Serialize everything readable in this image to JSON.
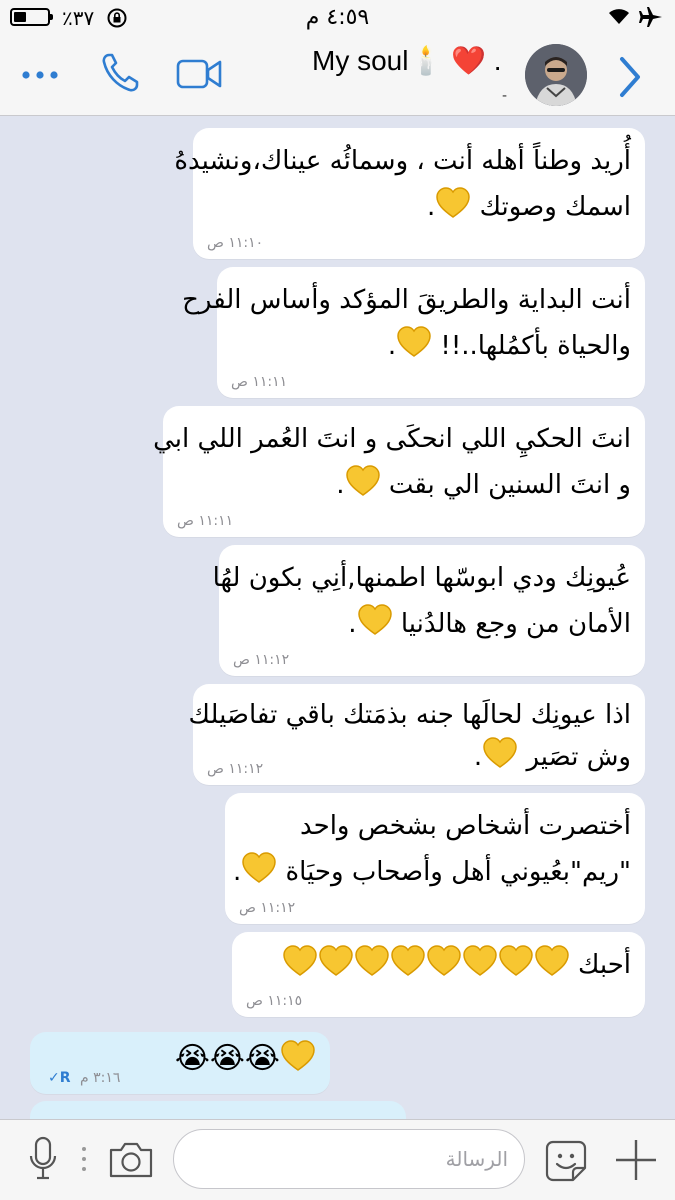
{
  "status_bar": {
    "battery_percent": "٪٣٧",
    "battery_level": 0.37,
    "time": "٤:٥٩ م"
  },
  "nav": {
    "chat_name": "My soul",
    "chat_name_emoji": "🕯️ ❤️ .",
    "subtitle": "-"
  },
  "messages": [
    {
      "lines": [
        "أُريد وطناً أهله أنت ، وسمائُه عيناك،ونشيدهُ",
        "اسمك وصوتك"
      ],
      "hearts": 1,
      "trail": ".",
      "time": "١١:١٠ ص"
    },
    {
      "lines": [
        "أنت البداية والطريقَ المؤكد وأساس الفرح",
        "والحياة بأكمُلها..!!"
      ],
      "hearts": 1,
      "trail": ".",
      "time": "١١:١١ ص"
    },
    {
      "lines": [
        "انتَ الحكيِ اللي انحكَى و انتَ العُمر اللي ابي",
        "و انتَ السنين الي بقت"
      ],
      "hearts": 1,
      "trail": ".",
      "time": "١١:١١ ص"
    },
    {
      "lines": [
        "عُيونِك ودي ابوسّها اطمنها,أنِي بكون لهُا",
        "الأمان من وجع هالدُنيا"
      ],
      "hearts": 1,
      "trail": ".",
      "time": "١١:١٢ ص"
    },
    {
      "lines": [
        "اذا عيونِك لحالَها جنه بذمَتك باقي تفاصَيلك",
        "وش تصَير"
      ],
      "hearts": 1,
      "trail": ".",
      "time": "١١:١٢ ص"
    },
    {
      "lines": [
        "أختصرت أشخاص بشخص واحد",
        "\"ريم\"بعُيوني أهل وأصحاب وحيَاة"
      ],
      "hearts": 1,
      "trail": ".",
      "time": "١١:١٢ ص"
    },
    {
      "lines": [
        "أحبك"
      ],
      "hearts": 8,
      "trail": "",
      "time": "١١:١٥ ص"
    }
  ],
  "outgoing": {
    "emoji": "😭😭😭",
    "hearts": 1,
    "time": "٣:١٦ م",
    "read_mark": "✓R"
  },
  "input": {
    "placeholder": "الرسالة"
  },
  "colors": {
    "accent": "#2f7dd1",
    "incoming_bubble": "#ffffff",
    "outgoing_bubble": "#d9f0fb",
    "chat_background": "#dfe3ef",
    "heart_yellow": "#f7c631"
  }
}
